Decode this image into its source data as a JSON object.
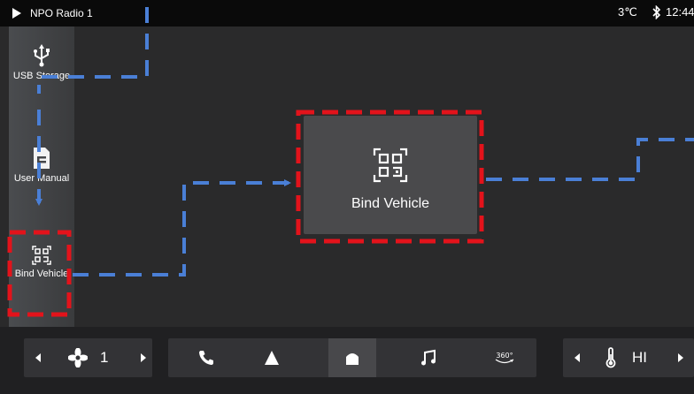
{
  "status_bar": {
    "media_title": "NPO Radio 1",
    "temperature": "3℃",
    "time": "12:44",
    "icons": [
      "play-icon",
      "bluetooth-icon"
    ]
  },
  "sidebar": {
    "items": [
      {
        "label": "USB Storage",
        "icon": "usb-icon"
      },
      {
        "label": "User Manual",
        "icon": "manual-icon"
      },
      {
        "label": "Bind Vehicle",
        "icon": "qr-scan-icon"
      }
    ]
  },
  "main_card": {
    "label": "Bind Vehicle",
    "icon": "qr-scan-icon"
  },
  "bottom_bar": {
    "fan_speed": "1",
    "climate_temp": "HI",
    "dock_items": [
      "phone-icon",
      "navigation-icon",
      "home-icon",
      "music-icon",
      "360-view-icon"
    ],
    "active_dock_item": "home-icon"
  },
  "colors": {
    "highlight_box": "#e3131b",
    "flow_arrow": "#4a7fd6",
    "background": "#2a2a2b"
  }
}
